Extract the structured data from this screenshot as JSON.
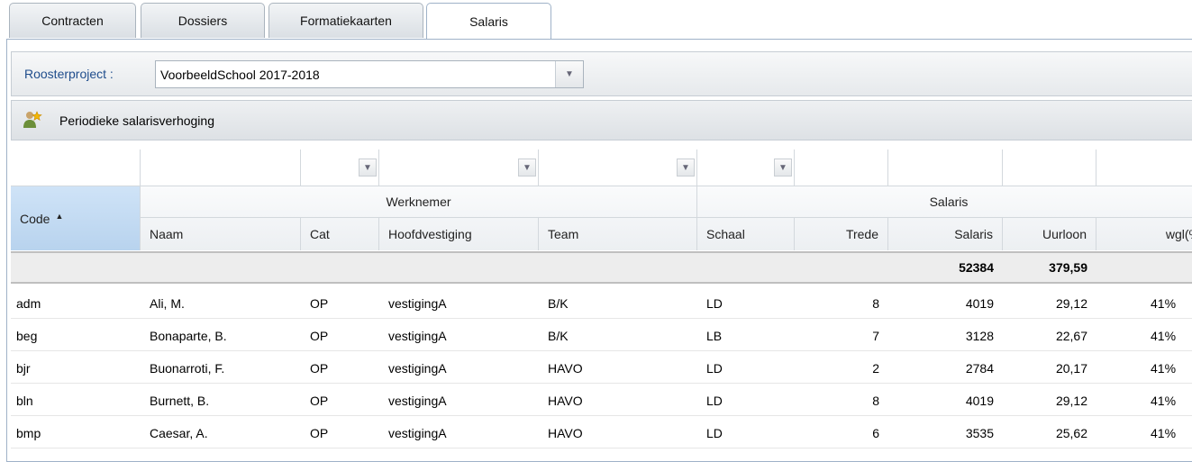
{
  "tabs": [
    {
      "label": "Contracten",
      "active": false
    },
    {
      "label": "Dossiers",
      "active": false
    },
    {
      "label": "Formatiekaarten",
      "active": false
    },
    {
      "label": "Salaris",
      "active": true
    }
  ],
  "project": {
    "label": "Roosterproject :",
    "selected": "VoorbeeldSchool 2017-2018"
  },
  "action": {
    "label": "Periodieke salarisverhoging",
    "icon": "person-star-icon"
  },
  "header": {
    "code": "Code",
    "group_werknemer": "Werknemer",
    "group_salaris": "Salaris",
    "naam": "Naam",
    "cat": "Cat",
    "hoofdvestiging": "Hoofdvestiging",
    "team": "Team",
    "schaal": "Schaal",
    "trede": "Trede",
    "salaris": "Salaris",
    "uurloon": "Uurloon",
    "wgl": "wgl(%"
  },
  "summary": {
    "salaris": "52384",
    "uurloon": "379,59"
  },
  "rows": [
    {
      "code": "adm",
      "naam": "Ali, M.",
      "cat": "OP",
      "vestiging": "vestigingA",
      "team": "B/K",
      "schaal": "LD",
      "trede": "8",
      "salaris": "4019",
      "uurloon": "29,12",
      "wgl": "41%"
    },
    {
      "code": "beg",
      "naam": "Bonaparte, B.",
      "cat": "OP",
      "vestiging": "vestigingA",
      "team": "B/K",
      "schaal": "LB",
      "trede": "7",
      "salaris": "3128",
      "uurloon": "22,67",
      "wgl": "41%"
    },
    {
      "code": "bjr",
      "naam": "Buonarroti, F.",
      "cat": "OP",
      "vestiging": "vestigingA",
      "team": "HAVO",
      "schaal": "LD",
      "trede": "2",
      "salaris": "2784",
      "uurloon": "20,17",
      "wgl": "41%"
    },
    {
      "code": "bln",
      "naam": "Burnett, B.",
      "cat": "OP",
      "vestiging": "vestigingA",
      "team": "HAVO",
      "schaal": "LD",
      "trede": "8",
      "salaris": "4019",
      "uurloon": "29,12",
      "wgl": "41%"
    },
    {
      "code": "bmp",
      "naam": "Caesar, A.",
      "cat": "OP",
      "vestiging": "vestigingA",
      "team": "HAVO",
      "schaal": "LD",
      "trede": "6",
      "salaris": "3535",
      "uurloon": "25,62",
      "wgl": "41%"
    }
  ]
}
